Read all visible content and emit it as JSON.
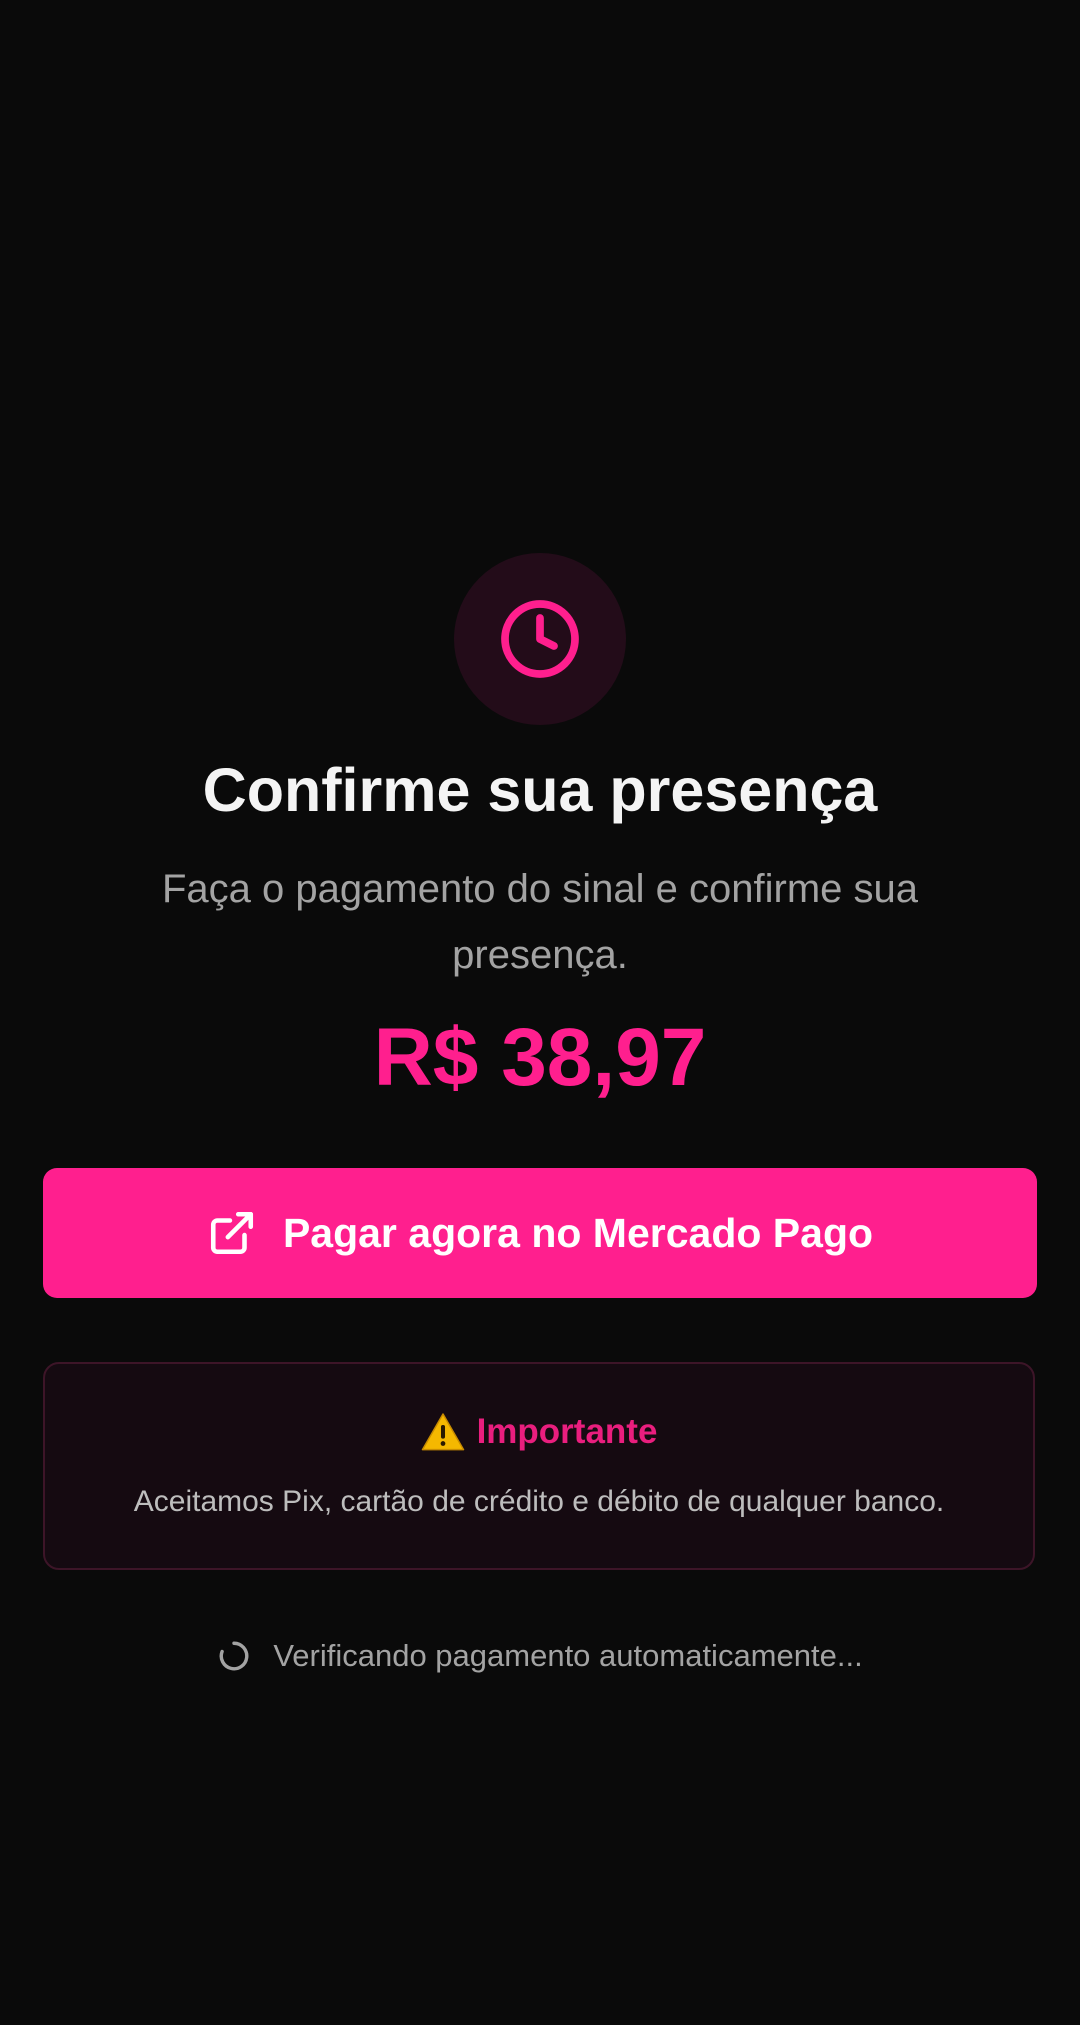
{
  "header": {
    "icon": "clock-icon",
    "title": "Confirme sua presença",
    "subtitle": "Faça o pagamento do sinal e confirme sua presença."
  },
  "payment": {
    "amount": "R$ 38,97",
    "button_label": "Pagar agora no Mercado Pago",
    "button_icon": "external-link-icon"
  },
  "notice": {
    "icon": "warning-icon",
    "title": "Importante",
    "text": "Aceitamos Pix, cartão de crédito e débito de qualquer banco."
  },
  "status": {
    "icon": "spinner-icon",
    "text": "Verificando pagamento automaticamente..."
  },
  "colors": {
    "background": "#0a0a0a",
    "accent": "#ff1f8e",
    "icon_circle": "#230c19",
    "notice_background": "#150a11",
    "notice_border": "#3d1528",
    "warning": "#f5b800"
  }
}
